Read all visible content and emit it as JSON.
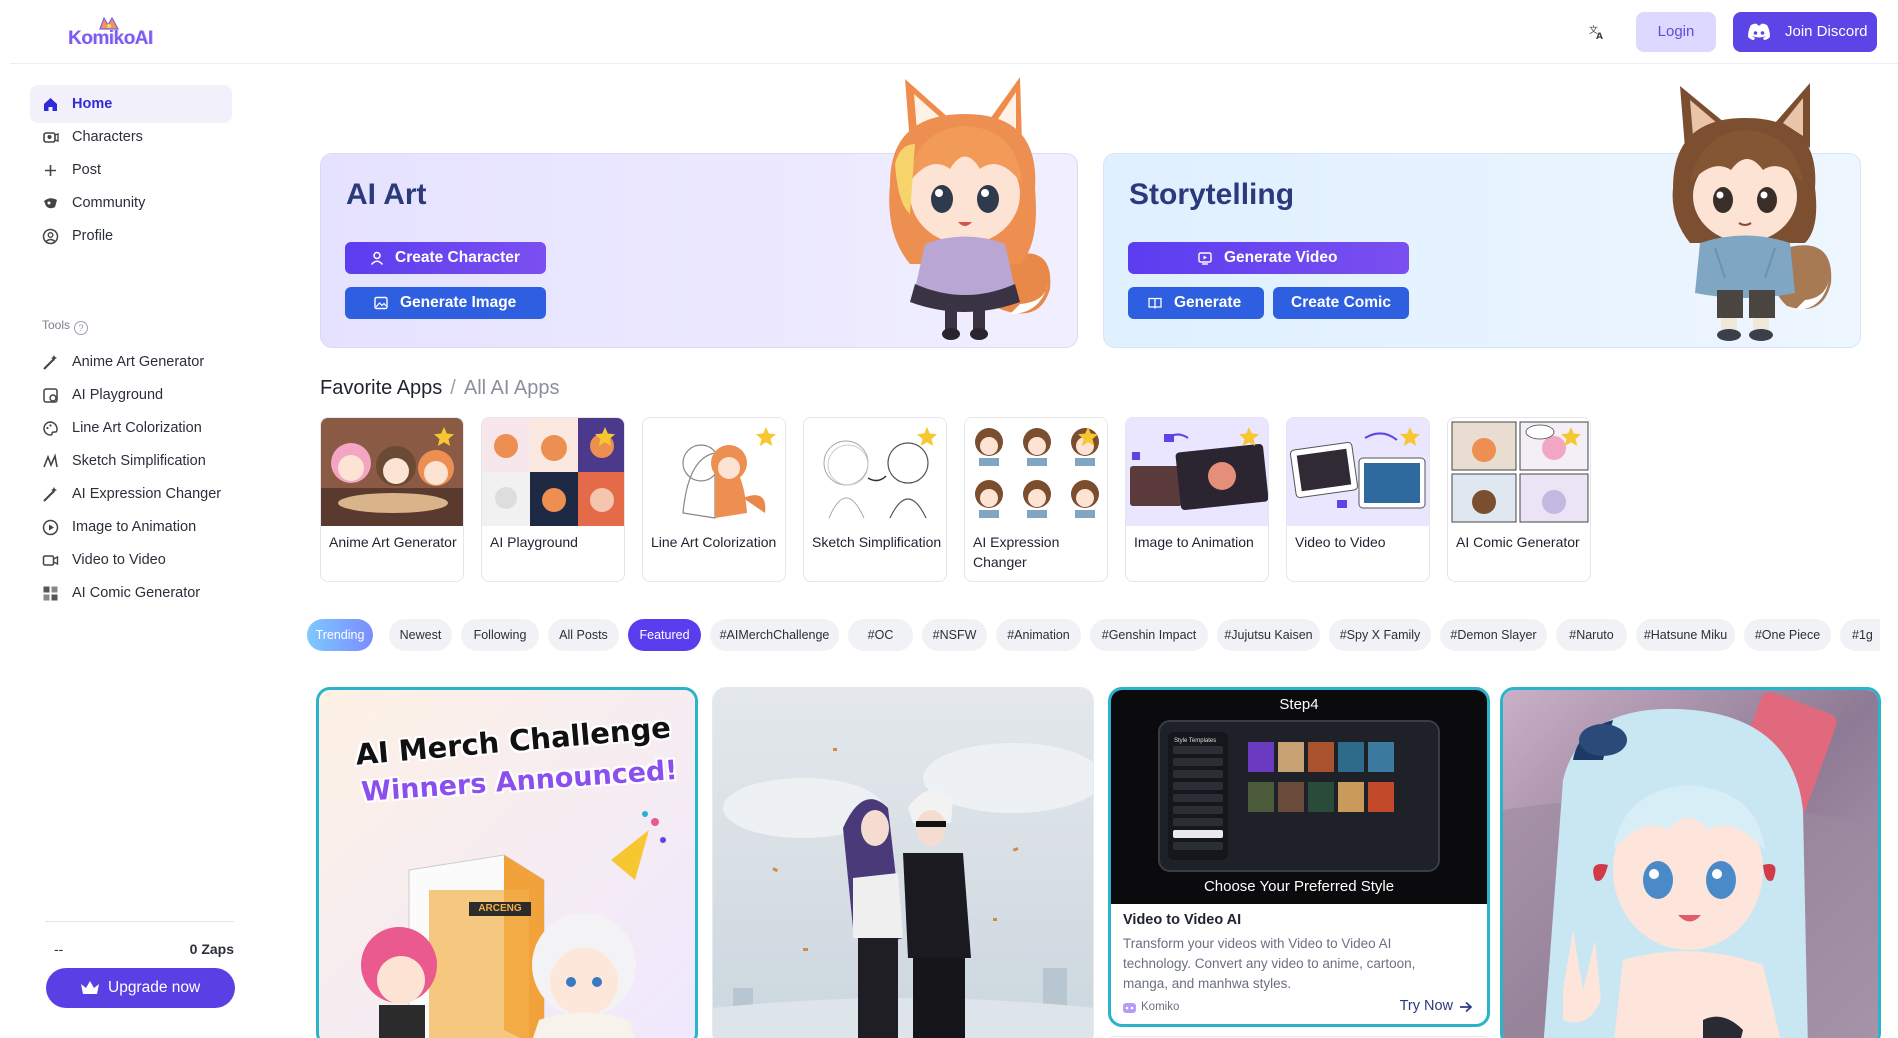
{
  "header": {
    "logo_text": "KomikoAI",
    "login_label": "Login",
    "discord_label": "Join Discord",
    "translate_icon": "translate-icon"
  },
  "sidebar": {
    "nav": [
      {
        "label": "Home",
        "icon": "home-icon",
        "active": true
      },
      {
        "label": "Characters",
        "icon": "characters-icon"
      },
      {
        "label": "Post",
        "icon": "plus-icon"
      },
      {
        "label": "Community",
        "icon": "community-icon"
      },
      {
        "label": "Profile",
        "icon": "profile-icon"
      }
    ],
    "tools_label": "Tools",
    "tools": [
      {
        "label": "Anime Art Generator",
        "icon": "magic-wand-icon"
      },
      {
        "label": "AI Playground",
        "icon": "playground-icon"
      },
      {
        "label": "Line Art Colorization",
        "icon": "palette-icon"
      },
      {
        "label": "Sketch Simplification",
        "icon": "sketch-icon"
      },
      {
        "label": "AI Expression Changer",
        "icon": "magic-wand-icon"
      },
      {
        "label": "Image to Animation",
        "icon": "play-circle-icon"
      },
      {
        "label": "Video to Video",
        "icon": "video-icon"
      },
      {
        "label": "AI Comic Generator",
        "icon": "comic-grid-icon"
      }
    ],
    "user_name": "--",
    "zaps": "0 Zaps",
    "upgrade_label": "Upgrade now"
  },
  "hero": {
    "art": {
      "title": "AI Art",
      "create_character": "Create Character",
      "generate_image": "Generate Image"
    },
    "story": {
      "title": "Storytelling",
      "generate_video": "Generate Video",
      "generate": "Generate",
      "create_comic": "Create Comic"
    }
  },
  "favorites": {
    "title": "Favorite Apps",
    "separator": "/",
    "all_label": "All AI Apps",
    "apps": [
      {
        "label": "Anime Art Generator"
      },
      {
        "label": "AI Playground"
      },
      {
        "label": "Line Art Colorization"
      },
      {
        "label": "Sketch Simplification"
      },
      {
        "label": "AI Expression Changer"
      },
      {
        "label": "Image to Animation"
      },
      {
        "label": "Video to Video"
      },
      {
        "label": "AI Comic Generator"
      }
    ]
  },
  "tags": [
    "Trending",
    "Newest",
    "Following",
    "All Posts",
    "Featured",
    "#AIMerchChallenge",
    "#OC",
    "#NSFW",
    "#Animation",
    "#Genshin Impact",
    "#Jujutsu Kaisen",
    "#Spy X Family",
    "#Demon Slayer",
    "#Naruto",
    "#Hatsune Miku",
    "#One Piece",
    "#1g"
  ],
  "feed": {
    "merch": {
      "line1": "AI Merch Challenge",
      "line2": "Winners Announced!",
      "box_label": "ARCENG"
    },
    "video": {
      "step": "Step4",
      "panel_title": "Style Templates",
      "caption": "Choose Your Preferred Style",
      "title": "Video to Video AI",
      "description": "Transform your videos with Video to Video AI technology. Convert any video to anime, cartoon, manga, and manhwa styles.",
      "author": "Komiko",
      "cta": "Try Now"
    }
  },
  "colors": {
    "accent": "#5b45e6",
    "active_nav_text": "#2f2bd6",
    "hero_title": "#2c3a7c",
    "selected_card_border": "#2ab3c9"
  }
}
